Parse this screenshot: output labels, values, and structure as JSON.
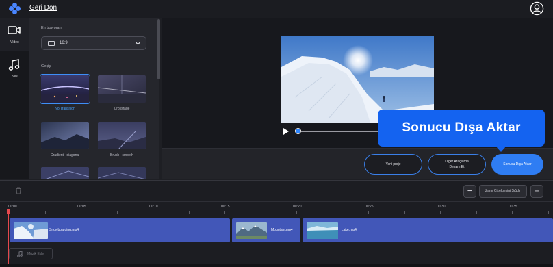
{
  "header": {
    "back_label": "Geri Dön"
  },
  "rail": {
    "items": [
      {
        "label": "Video",
        "icon": "video-camera-icon"
      },
      {
        "label": "Ses",
        "icon": "music-note-icon"
      }
    ]
  },
  "panel": {
    "aspect_label": "En boy oranı",
    "aspect_value": "16:9",
    "transitions_label": "Geçiş",
    "transitions": [
      {
        "label": "No Transition",
        "selected": true
      },
      {
        "label": "Crossfade",
        "selected": false
      },
      {
        "label": "Gradient - diagonal",
        "selected": false
      },
      {
        "label": "Brush - smooth",
        "selected": false
      }
    ]
  },
  "actions": {
    "new_project": "Yeni proje",
    "edit_other_line1": "Diğer Araçlarda",
    "edit_other_line2": "Devam Et",
    "export": "Sonucu Dışa Aktar"
  },
  "callout": {
    "text": "Sonucu Dışa Aktar"
  },
  "timeline": {
    "zoom_label": "Zamı Çizelgesini Sığdır",
    "ticks": [
      "00:00",
      "00:05",
      "00:10",
      "00:15",
      "00:20",
      "00:25",
      "00:30",
      "00:35"
    ],
    "clips": [
      {
        "name": "Snowboarding.mp4"
      },
      {
        "name": "Mountain.mp4"
      },
      {
        "name": "Lake.mp4"
      }
    ],
    "add_music": "Müzik Ekle"
  },
  "colors": {
    "accent": "#2f7df3",
    "callout": "#1463f0",
    "clip": "#4257b8",
    "playhead": "#e5484d"
  }
}
